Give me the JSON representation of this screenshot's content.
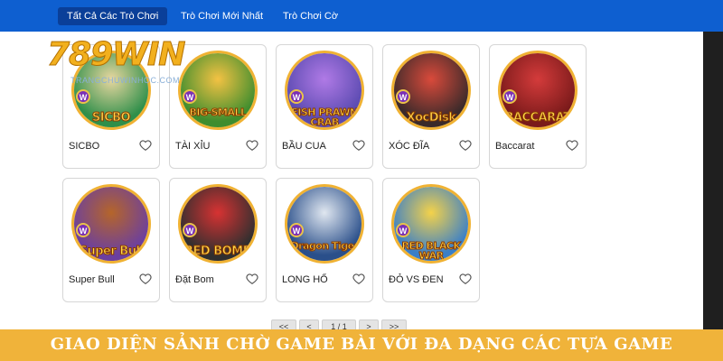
{
  "nav": {
    "tabs": [
      {
        "label": "Tất Cả Các Trò Chơi",
        "active": true
      },
      {
        "label": "Trò Chơi Mới Nhất",
        "active": false
      },
      {
        "label": "Trò Chơi Cờ",
        "active": false
      }
    ]
  },
  "logo": {
    "text": "789WIN",
    "subtext": "TRANGCHUWINHOC.COM"
  },
  "games": [
    {
      "art_label": "SICBO",
      "name": "SICBO",
      "bg": "#2f8f4a",
      "accent": "#e8d7a0"
    },
    {
      "art_label": "BIG-SMALL",
      "name": "TÀI XỈU",
      "bg": "#3f8d2e",
      "accent": "#f3c243"
    },
    {
      "art_label": "FISH PRAWN CRAB",
      "name": "BẦU CUA",
      "bg": "#5a4ab0",
      "accent": "#b07ae6"
    },
    {
      "art_label": "XocDisk",
      "name": "XÓC ĐĨA",
      "bg": "#3a2a2a",
      "accent": "#d94a3b"
    },
    {
      "art_label": "BACCARAT",
      "name": "Baccarat",
      "bg": "#7a1a1a",
      "accent": "#d43b3b"
    },
    {
      "art_label": "Super Bull",
      "name": "Super Bull",
      "bg": "#6b3fa0",
      "accent": "#b5652a"
    },
    {
      "art_label": "RED BOMB",
      "name": "Đặt Bom",
      "bg": "#2f2f2f",
      "accent": "#d73232"
    },
    {
      "art_label": "Dragon Tiger",
      "name": "LONG HỔ",
      "bg": "#2a4f8a",
      "accent": "#e0e7f0"
    },
    {
      "art_label": "RED BLACK WAR",
      "name": "ĐỎ VS ĐEN",
      "bg": "#3a7fc8",
      "accent": "#f4d24a"
    }
  ],
  "badge_letter": "W",
  "pagination": {
    "first": "<<",
    "prev": "<",
    "page": "1 / 1",
    "next": ">",
    "last": ">>"
  },
  "banner": {
    "text": "GIAO DIỆN SẢNH CHỜ GAME BÀI VỚI ĐA DẠNG CÁC TỰA GAME"
  },
  "colors": {
    "nav_bg": "#0e5fd0",
    "nav_active": "#0a3f99",
    "banner_bg": "#f0b33a",
    "ring": "#f0b233"
  }
}
